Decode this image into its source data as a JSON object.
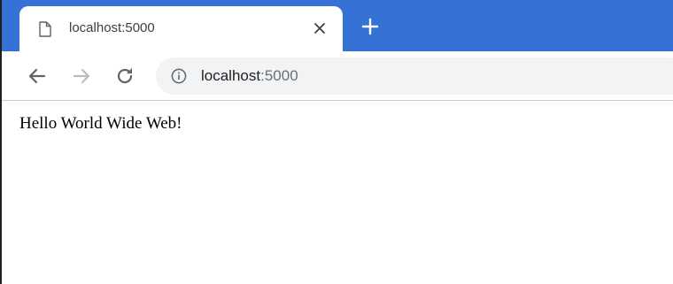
{
  "tab": {
    "title": "localhost:5000",
    "page_icon": "page-icon",
    "close_icon": "close-icon"
  },
  "new_tab": {
    "icon": "plus-icon"
  },
  "toolbar": {
    "back_icon": "arrow-left-icon",
    "forward_icon": "arrow-right-icon",
    "reload_icon": "reload-icon"
  },
  "omnibox": {
    "info_icon": "info-icon",
    "url_host": "localhost",
    "url_port": ":5000"
  },
  "page": {
    "body_text": "Hello World Wide Web!"
  },
  "colors": {
    "tabstrip": "#3672d6",
    "omnibox_bg": "#f1f3f4",
    "forward_disabled": "#b8bcc0",
    "icon": "#5f6368"
  }
}
